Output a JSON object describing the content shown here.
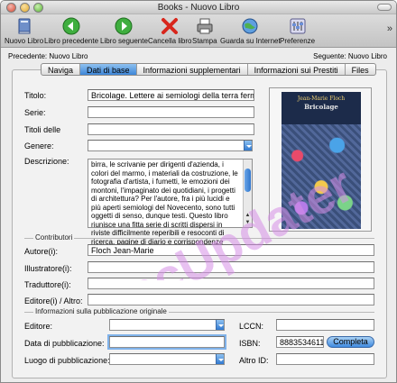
{
  "window": {
    "title": "Books - Nuovo Libro"
  },
  "toolbar": {
    "items": [
      {
        "label": "Nuovo Libro",
        "icon": "new-book-icon"
      },
      {
        "label": "Libro precedente",
        "icon": "arrow-left-green-icon"
      },
      {
        "label": "Libro seguente",
        "icon": "arrow-right-green-icon"
      },
      {
        "label": "Cancella libro",
        "icon": "red-x-icon"
      },
      {
        "label": "Stampa",
        "icon": "printer-icon"
      },
      {
        "label": "Guarda su Internet",
        "icon": "globe-icon"
      },
      {
        "label": "Preferenze",
        "icon": "preferences-icon"
      }
    ],
    "more": "»"
  },
  "nav": {
    "prev": "Precedente: Nuovo Libro",
    "next": "Seguente: Nuovo Libro"
  },
  "tabs": [
    "Naviga",
    "Dati di base",
    "Informazioni supplementari",
    "Informazioni sui Prestiti",
    "Files"
  ],
  "active_tab": "Dati di base",
  "form": {
    "titolo_label": "Titolo:",
    "titolo_value": "Bricolage. Lettere ai semiologi della terra ferma",
    "serie_label": "Serie:",
    "serie_value": "",
    "titoli_delle_label": "Titoli delle",
    "titoli_delle_value": "",
    "genere_label": "Genere:",
    "genere_value": "",
    "descrizione_label": "Descrizione:",
    "descrizione_value": "birra, le scrivanie per dirigenti d'azienda, i colori del marmo, i materiali da costruzione, le fotografia d'artista, i fumetti, le emozioni dei montoni, l'impaginato dei quotidiani, i progetti di architettura? Per l'autore, fra i più lucidi e più aperti semiologi del Novecento, sono tutti oggetti di senso, dunque testi. Questo libro riunisce una fitta serie di scritti dispersi in riviste difficilmente reperibili e resoconti di ricerca, pagine di diario e corrispondenze ideali con amici e"
  },
  "cover": {
    "author": "Jean-Marie Floch",
    "title": "Bricolage"
  },
  "contributors": {
    "section_label": "Contributori",
    "autore_label": "Autore(i):",
    "autore_value": "Floch Jean-Marie",
    "illustratore_label": "Illustratore(i):",
    "illustratore_value": "",
    "traduttore_label": "Traduttore(i):",
    "traduttore_value": "",
    "editore_altro_label": "Editore(i) / Altro:",
    "editore_altro_value": ""
  },
  "publication": {
    "section_label": "Informazioni sulla pubblicazione originale",
    "editore_label": "Editore:",
    "editore_value": "",
    "data_label": "Data di pubblicazione:",
    "data_value": "",
    "luogo_label": "Luogo di pubblicazione:",
    "luogo_value": "",
    "lccn_label": "LCCN:",
    "lccn_value": "",
    "isbn_label": "ISBN:",
    "isbn_value": "8883534611",
    "completa_label": "Completa",
    "altro_id_label": "Altro ID:",
    "altro_id_value": ""
  },
  "watermark": {
    "text": "MacUpdater",
    "color": "#d58ee6"
  }
}
